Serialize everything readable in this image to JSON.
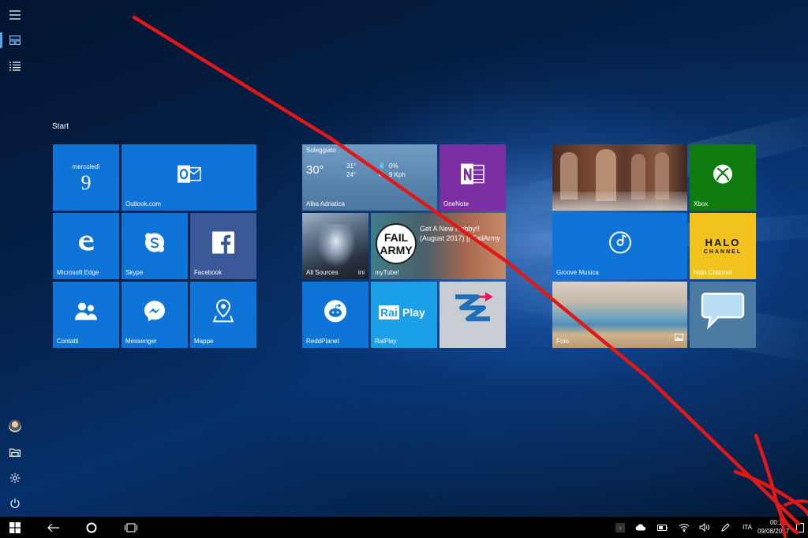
{
  "start": {
    "title": "Start"
  },
  "rail": {
    "items": [
      {
        "name": "menu-icon"
      },
      {
        "name": "pinned-tiles-icon"
      },
      {
        "name": "all-apps-list-icon"
      },
      {
        "name": "user-avatar"
      },
      {
        "name": "file-explorer-icon"
      },
      {
        "name": "settings-icon"
      },
      {
        "name": "power-icon"
      }
    ]
  },
  "tiles": {
    "calendar": {
      "day": "mercoledì",
      "date": "9"
    },
    "outlook": {
      "label": "Outlook.com"
    },
    "edge": {
      "label": "Microsoft Edge"
    },
    "skype": {
      "label": "Skype"
    },
    "facebook": {
      "label": "Facebook"
    },
    "contacts": {
      "label": "Contatti"
    },
    "messenger": {
      "label": "Messenger"
    },
    "maps": {
      "label": "Mappe"
    },
    "weather": {
      "condition": "Soleggiato",
      "temp": "30°",
      "high": "31°",
      "low": "24°",
      "rain": "0%",
      "wind": "9 Kph",
      "city": "Alba Adriatica"
    },
    "onenote": {
      "label": "OneNote"
    },
    "allsources": {
      "label": "All Sources",
      "count": "ini"
    },
    "mytube": {
      "label": "myTube!",
      "title": "Get A New Hobby!! (August 2017) || FailArmy",
      "logo_top": "FAIL",
      "logo_bottom": "ARMY"
    },
    "reddplanet": {
      "label": "ReddPlanet"
    },
    "raiplay": {
      "label": "RaiPlay",
      "logo_a": "Rai",
      "logo_b": "Play"
    },
    "xbox": {
      "label": "Xbox"
    },
    "groove": {
      "label": "Groove Musica"
    },
    "halo": {
      "label": "Halo Channel",
      "logo_a": "HALO",
      "logo_b": "CHANNEL"
    },
    "photos": {
      "label": "Foto"
    }
  },
  "taskbar": {
    "language": "ITA",
    "time": "00:12",
    "date": "09/08/2017"
  },
  "colors": {
    "tile_blue": "#0f74d8",
    "onenote": "#7d2ea3",
    "xbox": "#107c10",
    "halo": "#f2c31d",
    "annotation": "#e01818"
  }
}
